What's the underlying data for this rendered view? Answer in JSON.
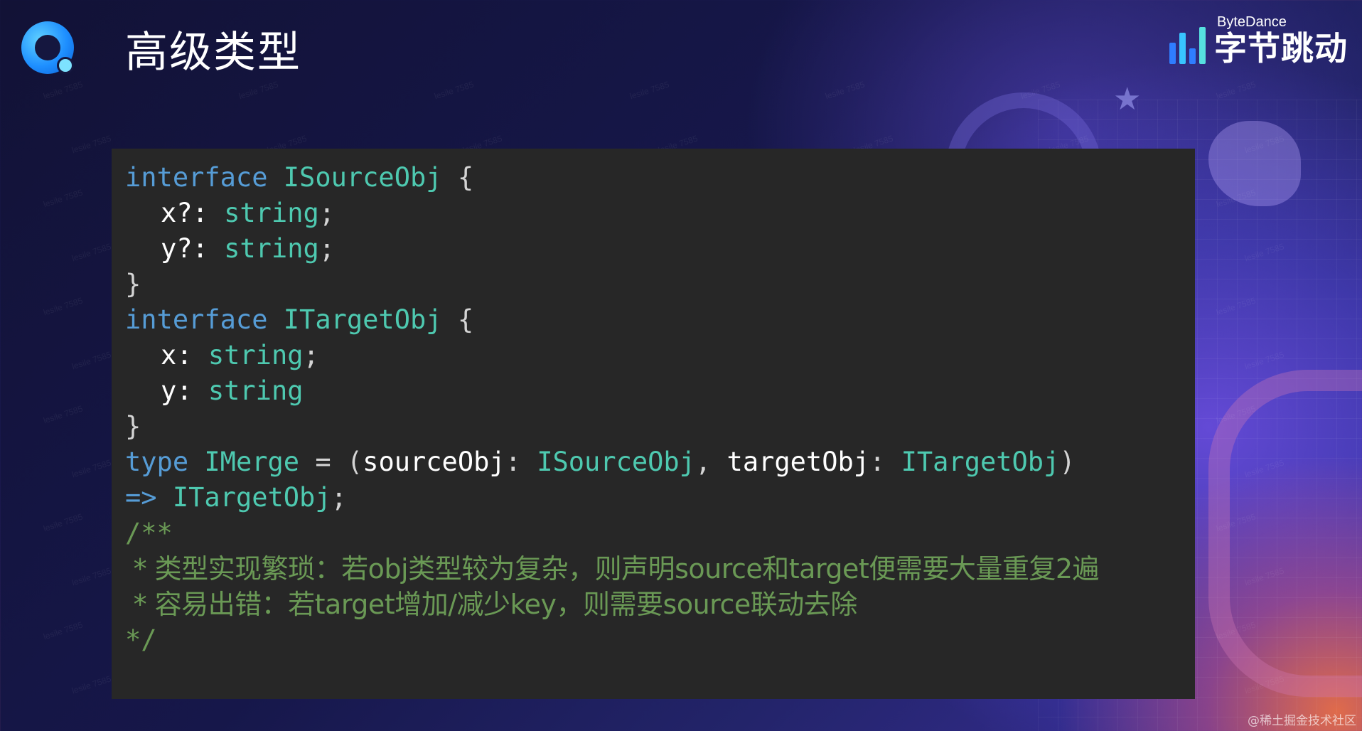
{
  "slide": {
    "title": "高级类型",
    "logo_icon": "circle-q-logo"
  },
  "brand": {
    "en": "ByteDance",
    "cn": "字节跳动",
    "bar_colors": [
      "#2f7dff",
      "#38c4ff",
      "#2f7dff",
      "#56e0e0"
    ]
  },
  "code": {
    "interface_kw": "interface",
    "type_kw": "type",
    "source_name": "ISourceObj",
    "target_name": "ITargetObj",
    "merge_name": "IMerge",
    "open_brace": "{",
    "close_brace": "}",
    "x_optional": "x?:",
    "y_optional": "y?:",
    "x_prop": "x:",
    "y_prop": "y:",
    "string_type": "string",
    "semicolon": ";",
    "equals": "=",
    "open_paren": "(",
    "close_paren": ")",
    "source_param": "sourceObj",
    "target_param": "targetObj",
    "colon": ":",
    "comma": ",",
    "arrow": "=>",
    "comment_open": "/**",
    "comment_line_1": " * 类型实现繁琐：若obj类型较为复杂，则声明source和target便需要大量重复2遍",
    "comment_line_2": " * 容易出错：若target增加/减少key，则需要source联动去除",
    "comment_close": "*/"
  },
  "watermark": "lesile 7585",
  "credit": "@稀土掘金技术社区",
  "colors": {
    "keyword": "#569cd6",
    "type": "#4ec9b0",
    "comment": "#6a9955",
    "code_bg": "#272727"
  }
}
